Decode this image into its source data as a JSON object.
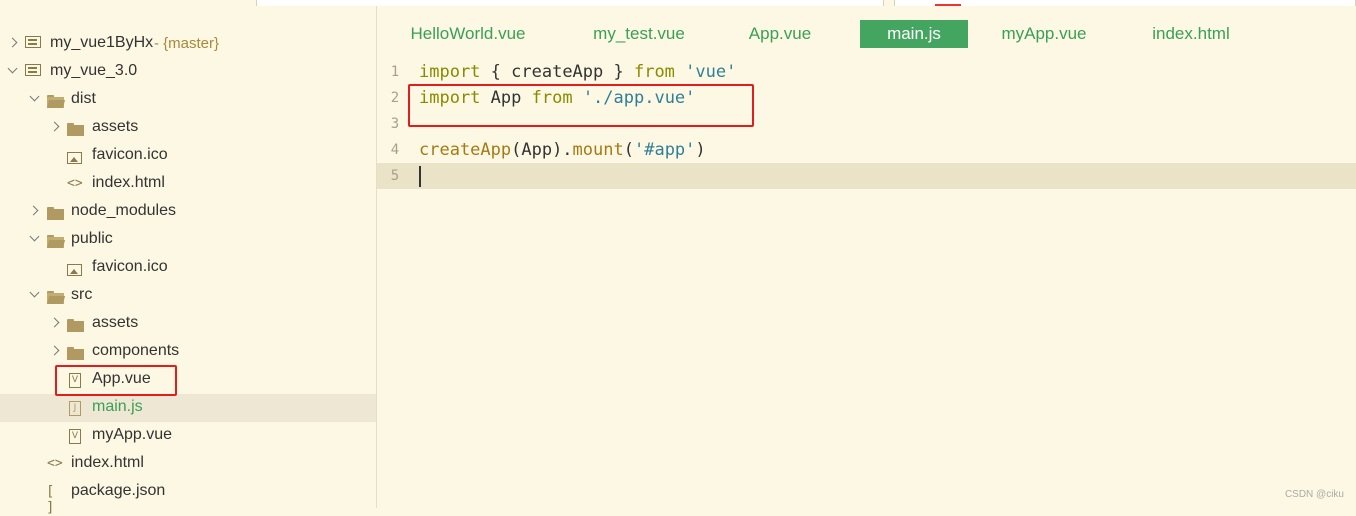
{
  "sidebar": {
    "tree": [
      {
        "label": "my_vue1ByHx",
        "branch": "- {master}"
      },
      {
        "label": "my_vue_3.0"
      },
      {
        "label": "dist"
      },
      {
        "label": "assets"
      },
      {
        "label": "favicon.ico"
      },
      {
        "label": "index.html"
      },
      {
        "label": "node_modules"
      },
      {
        "label": "public"
      },
      {
        "label": "favicon.ico"
      },
      {
        "label": "src"
      },
      {
        "label": "assets"
      },
      {
        "label": "components"
      },
      {
        "label": "App.vue"
      },
      {
        "label": "main.js"
      },
      {
        "label": "myApp.vue"
      },
      {
        "label": "index.html"
      },
      {
        "label": "package.json"
      }
    ]
  },
  "editor": {
    "tabs": [
      {
        "label": "HelloWorld.vue"
      },
      {
        "label": "my_test.vue"
      },
      {
        "label": "App.vue"
      },
      {
        "label": "main.js",
        "active": true
      },
      {
        "label": "myApp.vue"
      },
      {
        "label": "index.html"
      }
    ],
    "lines": [
      {
        "num": "1",
        "tokens": [
          [
            "kw",
            "import"
          ],
          [
            "",
            "{ createApp } "
          ],
          [
            "kw",
            "from"
          ],
          [
            "",
            ""
          ],
          [
            "str",
            " 'vue'"
          ]
        ]
      },
      {
        "num": "2",
        "tokens": [
          [
            "kw",
            "import"
          ],
          [
            "",
            "",
            " "
          ],
          [
            "",
            "App "
          ],
          [
            "kw",
            "from"
          ],
          [
            "str",
            " './app.vue'"
          ]
        ]
      },
      {
        "num": "3",
        "tokens": []
      },
      {
        "num": "4",
        "tokens": [
          [
            "fn",
            "createApp"
          ],
          [
            "",
            "(App)."
          ],
          [
            "fn",
            "mount"
          ],
          [
            "",
            "("
          ],
          [
            "str",
            "'#app'"
          ],
          [
            "",
            ")"
          ]
        ]
      },
      {
        "num": "5",
        "tokens": []
      }
    ]
  },
  "watermark": "CSDN @ciku",
  "colors": {
    "accent": "#43a560",
    "highlight_box": "#e31d1d",
    "background": "#fdf8e3"
  }
}
